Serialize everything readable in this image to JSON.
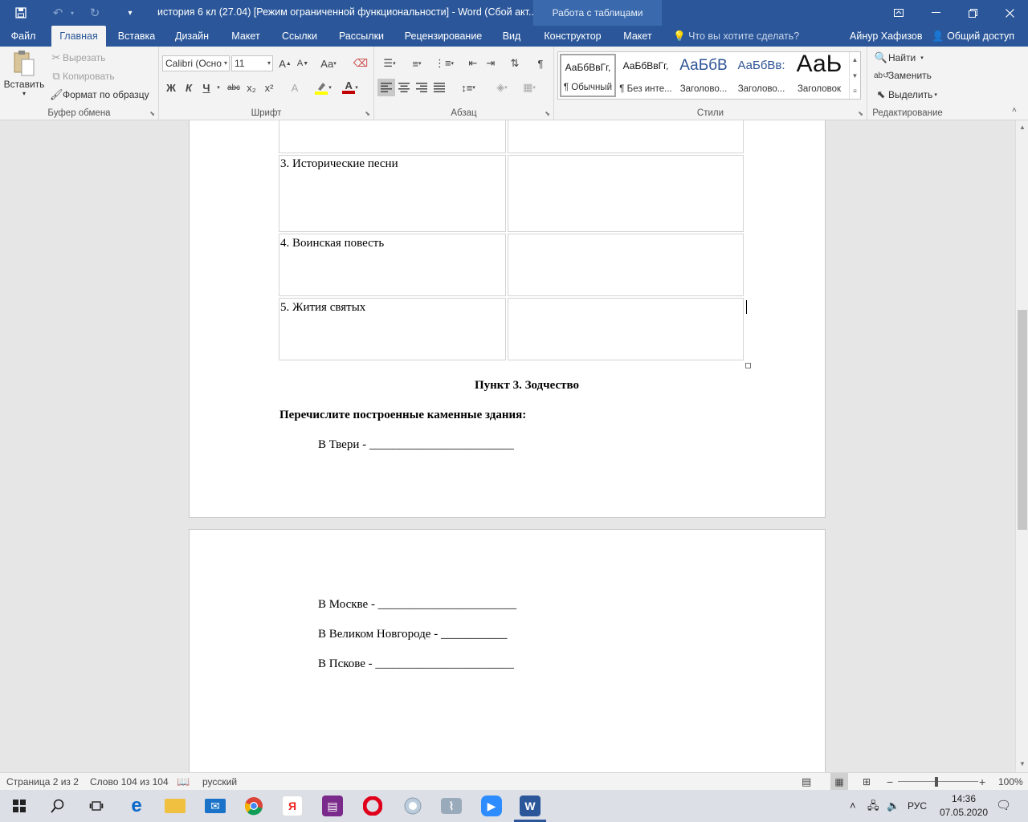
{
  "titlebar": {
    "title": "история 6 кл (27.04) [Режим ограниченной функциональности] - Word (Сбой акт...",
    "context_tab": "Работа с таблицами"
  },
  "tabs": {
    "file": "Файл",
    "home": "Главная",
    "insert": "Вставка",
    "design": "Дизайн",
    "layout": "Макет",
    "references": "Ссылки",
    "mailings": "Рассылки",
    "review": "Рецензирование",
    "view": "Вид",
    "constructor": "Конструктор",
    "table_layout": "Макет",
    "tell_me": "Что вы хотите сделать?",
    "user": "Айнур Хафизов",
    "share": "Общий доступ"
  },
  "ribbon": {
    "clipboard": {
      "label": "Буфер обмена",
      "paste": "Вставить",
      "cut": "Вырезать",
      "copy": "Копировать",
      "format_painter": "Формат по образцу"
    },
    "font": {
      "label": "Шрифт",
      "font_name": "Calibri (Осно",
      "font_size": "11",
      "bold": "Ж",
      "italic": "К",
      "underline": "Ч",
      "strike": "abc",
      "subscript": "x₂",
      "superscript": "x²",
      "grow": "A",
      "shrink": "A",
      "case": "Aa",
      "effects": "A",
      "color": "A"
    },
    "paragraph": {
      "label": "Абзац"
    },
    "styles": {
      "label": "Стили",
      "items": [
        {
          "sample": "АаБбВвГг,",
          "name": "¶ Обычный"
        },
        {
          "sample": "АаБбВвГг,",
          "name": "¶ Без инте..."
        },
        {
          "sample": "АаБбВ",
          "name": "Заголово..."
        },
        {
          "sample": "АаБбВв:",
          "name": "Заголово..."
        },
        {
          "sample": "АаЬ",
          "name": "Заголовок"
        }
      ]
    },
    "editing": {
      "label": "Редактирование",
      "find": "Найти",
      "replace": "Заменить",
      "select": "Выделить"
    }
  },
  "document": {
    "table_rows": [
      {
        "left": "3. Исторические песни",
        "right": ""
      },
      {
        "left": "4. Воинская повесть",
        "right": ""
      },
      {
        "left": "5. Жития святых",
        "right": ""
      }
    ],
    "heading": "Пункт 3. Зодчество",
    "instruction": "Перечислите построенные каменные здания:",
    "line_tver": "В Твери - ________________________",
    "line_moscow": "В Москве - _______________________",
    "line_novgorod": "В Великом Новгороде - ___________",
    "line_pskov": "В Пскове - _______________________"
  },
  "status": {
    "page": "Страница 2 из 2",
    "words": "Слово 104 из 104",
    "language": "русский",
    "zoom": "100%"
  },
  "taskbar": {
    "lang": "РУС",
    "time": "14:36",
    "date": "07.05.2020"
  },
  "colors": {
    "accent": "#2b579a",
    "font_color": "#c00000",
    "highlight": "#ffff00"
  }
}
